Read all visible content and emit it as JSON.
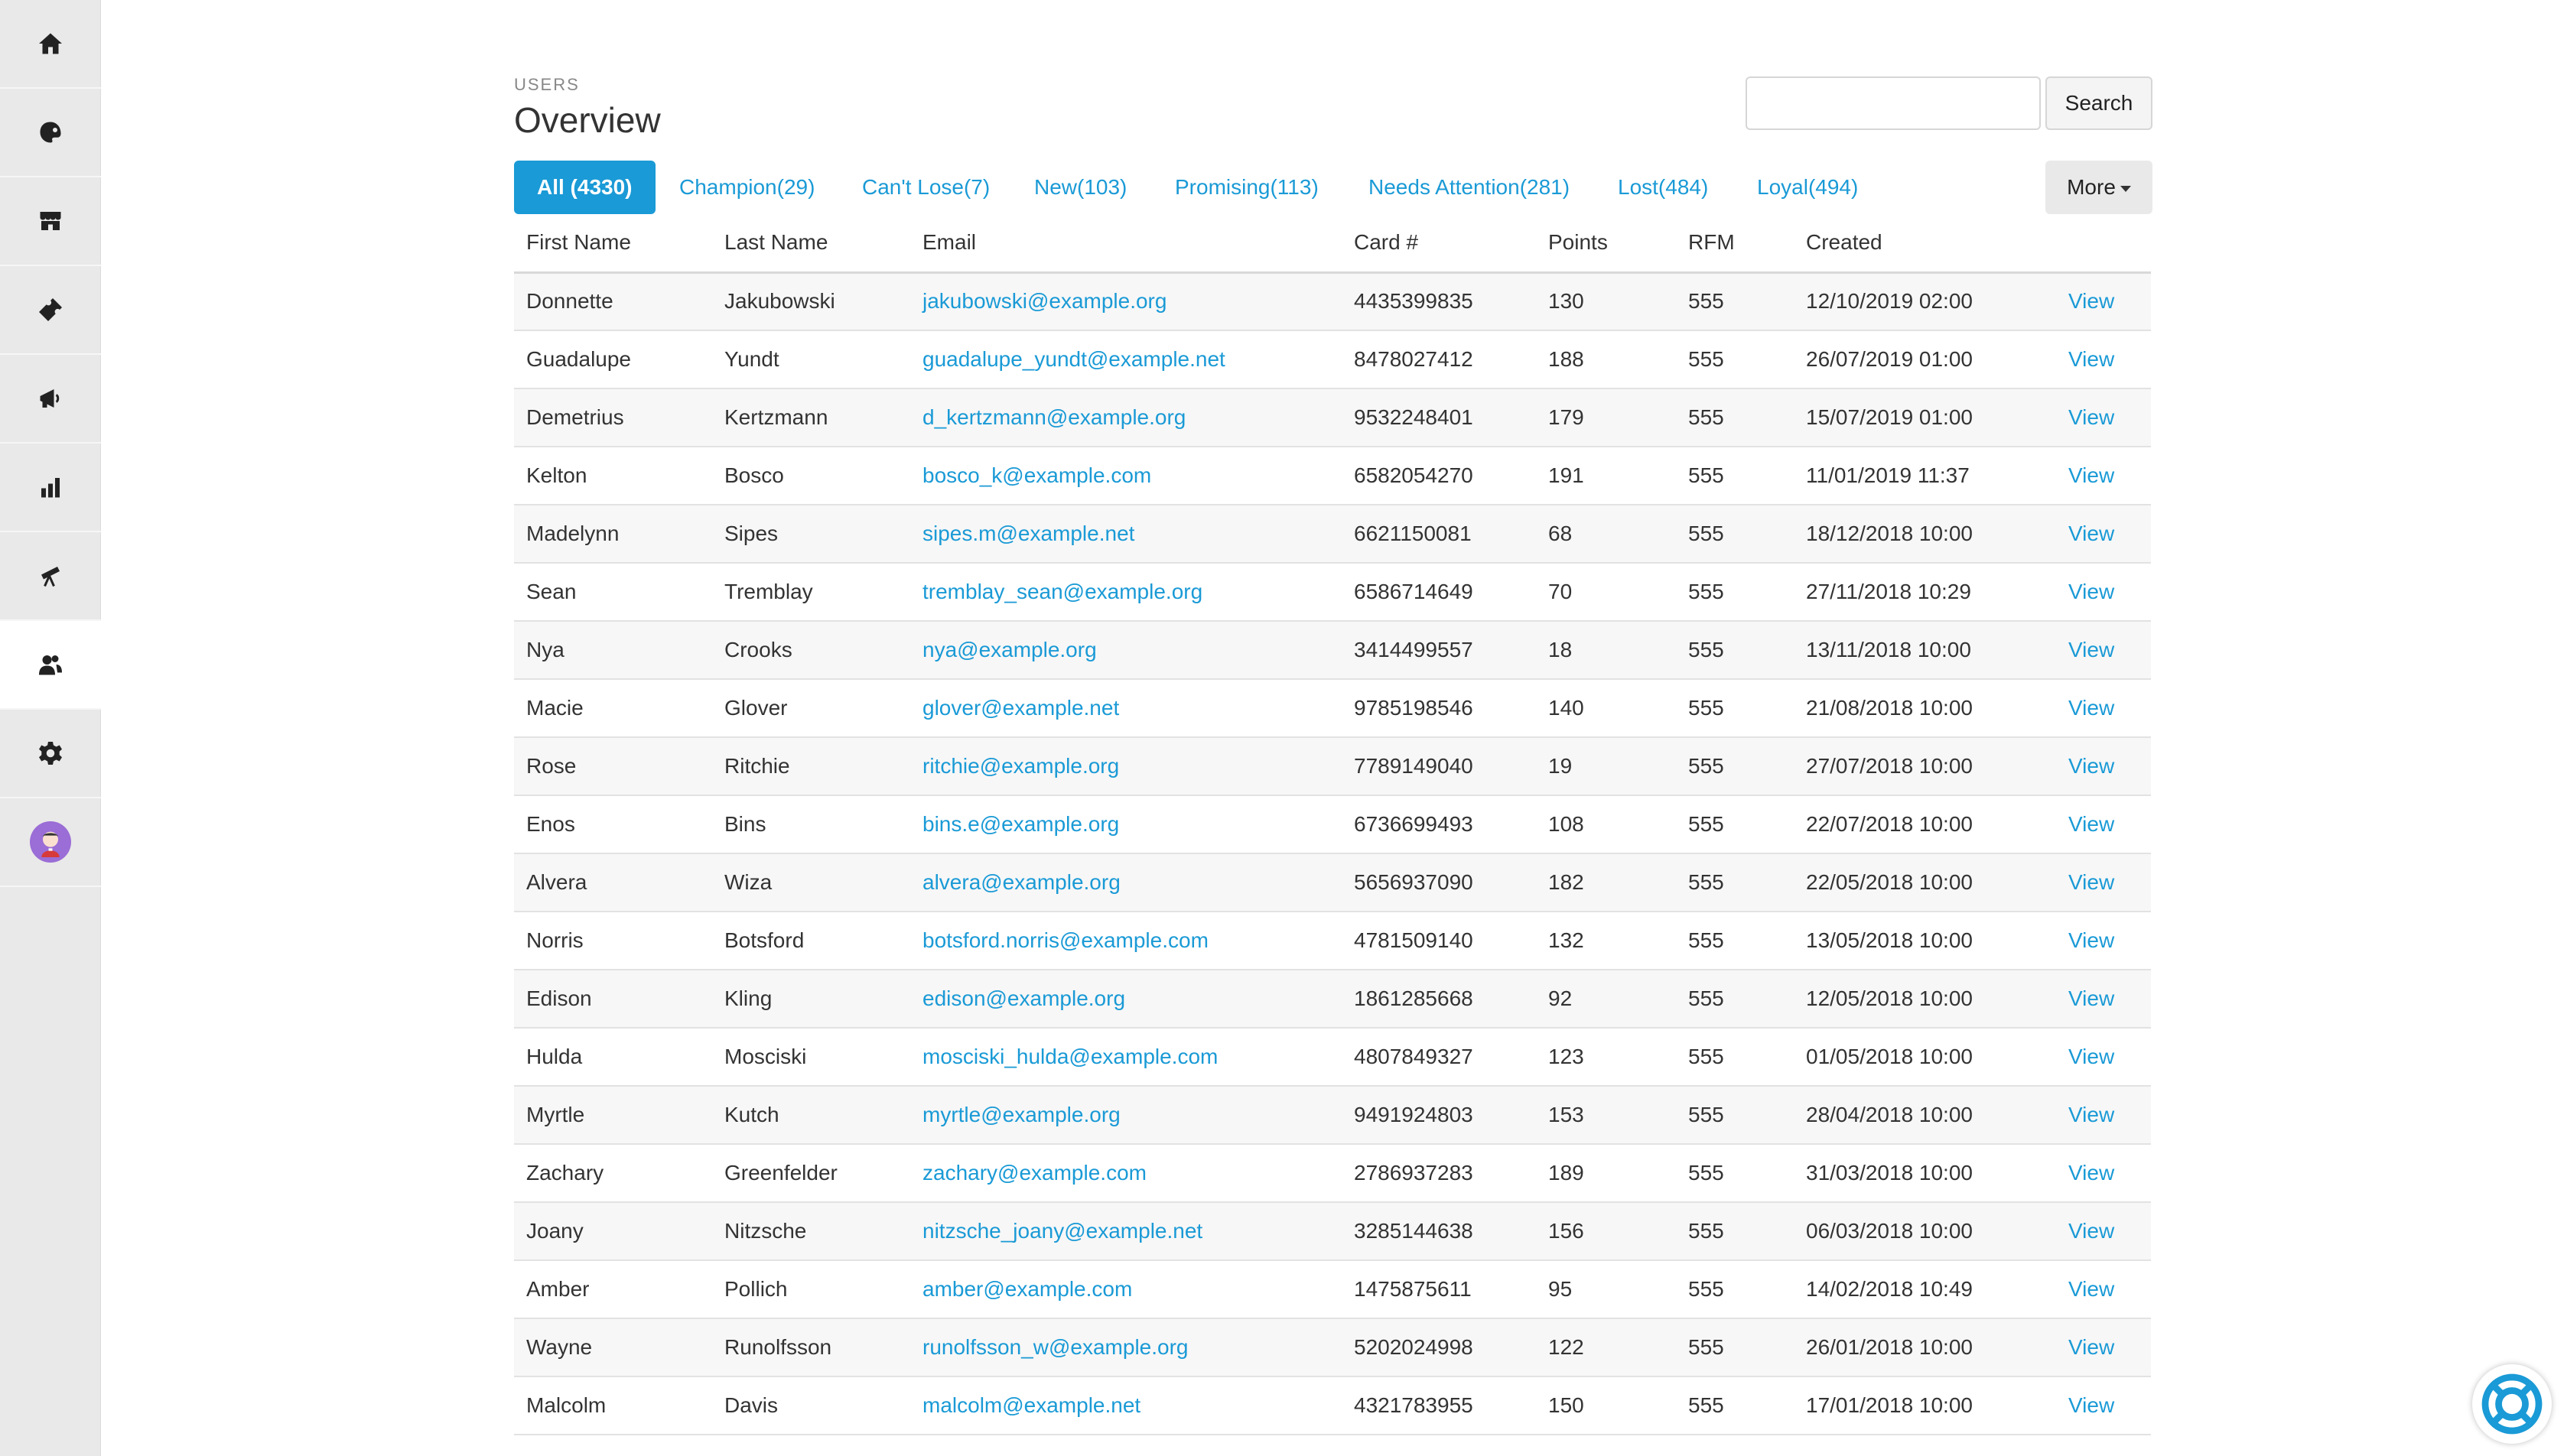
{
  "sidebar": {
    "items": [
      {
        "icon": "home-icon"
      },
      {
        "icon": "palette-icon"
      },
      {
        "icon": "store-icon"
      },
      {
        "icon": "ticket-icon"
      },
      {
        "icon": "megaphone-icon"
      },
      {
        "icon": "bar-chart-icon"
      },
      {
        "icon": "telescope-icon"
      },
      {
        "icon": "users-icon",
        "active": true
      },
      {
        "icon": "gear-icon"
      },
      {
        "icon": "avatar"
      }
    ]
  },
  "header": {
    "section": "USERS",
    "title": "Overview"
  },
  "search": {
    "value": "",
    "placeholder": "",
    "button_label": "Search"
  },
  "tabs": [
    {
      "label": "All (4330)",
      "active": true
    },
    {
      "label": "Champion(29)"
    },
    {
      "label": "Can't Lose(7)"
    },
    {
      "label": "New(103)"
    },
    {
      "label": "Promising(113)"
    },
    {
      "label": "Needs Attention(281)"
    },
    {
      "label": "Lost(484)"
    },
    {
      "label": "Loyal(494)"
    }
  ],
  "more_label": "More",
  "table": {
    "columns": [
      "First Name",
      "Last Name",
      "Email",
      "Card #",
      "Points",
      "RFM",
      "Created",
      ""
    ],
    "action_label": "View",
    "rows": [
      [
        "Donnette",
        "Jakubowski",
        "jakubowski@example.org",
        "4435399835",
        "130",
        "555",
        "12/10/2019 02:00"
      ],
      [
        "Guadalupe",
        "Yundt",
        "guadalupe_yundt@example.net",
        "8478027412",
        "188",
        "555",
        "26/07/2019 01:00"
      ],
      [
        "Demetrius",
        "Kertzmann",
        "d_kertzmann@example.org",
        "9532248401",
        "179",
        "555",
        "15/07/2019 01:00"
      ],
      [
        "Kelton",
        "Bosco",
        "bosco_k@example.com",
        "6582054270",
        "191",
        "555",
        "11/01/2019 11:37"
      ],
      [
        "Madelynn",
        "Sipes",
        "sipes.m@example.net",
        "6621150081",
        "68",
        "555",
        "18/12/2018 10:00"
      ],
      [
        "Sean",
        "Tremblay",
        "tremblay_sean@example.org",
        "6586714649",
        "70",
        "555",
        "27/11/2018 10:29"
      ],
      [
        "Nya",
        "Crooks",
        "nya@example.org",
        "3414499557",
        "18",
        "555",
        "13/11/2018 10:00"
      ],
      [
        "Macie",
        "Glover",
        "glover@example.net",
        "9785198546",
        "140",
        "555",
        "21/08/2018 10:00"
      ],
      [
        "Rose",
        "Ritchie",
        "ritchie@example.org",
        "7789149040",
        "19",
        "555",
        "27/07/2018 10:00"
      ],
      [
        "Enos",
        "Bins",
        "bins.e@example.org",
        "6736699493",
        "108",
        "555",
        "22/07/2018 10:00"
      ],
      [
        "Alvera",
        "Wiza",
        "alvera@example.org",
        "5656937090",
        "182",
        "555",
        "22/05/2018 10:00"
      ],
      [
        "Norris",
        "Botsford",
        "botsford.norris@example.com",
        "4781509140",
        "132",
        "555",
        "13/05/2018 10:00"
      ],
      [
        "Edison",
        "Kling",
        "edison@example.org",
        "1861285668",
        "92",
        "555",
        "12/05/2018 10:00"
      ],
      [
        "Hulda",
        "Mosciski",
        "mosciski_hulda@example.com",
        "4807849327",
        "123",
        "555",
        "01/05/2018 10:00"
      ],
      [
        "Myrtle",
        "Kutch",
        "myrtle@example.org",
        "9491924803",
        "153",
        "555",
        "28/04/2018 10:00"
      ],
      [
        "Zachary",
        "Greenfelder",
        "zachary@example.com",
        "2786937283",
        "189",
        "555",
        "31/03/2018 10:00"
      ],
      [
        "Joany",
        "Nitzsche",
        "nitzsche_joany@example.net",
        "3285144638",
        "156",
        "555",
        "06/03/2018 10:00"
      ],
      [
        "Amber",
        "Pollich",
        "amber@example.com",
        "1475875611",
        "95",
        "555",
        "14/02/2018 10:49"
      ],
      [
        "Wayne",
        "Runolfsson",
        "runolfsson_w@example.org",
        "5202024998",
        "122",
        "555",
        "26/01/2018 10:00"
      ],
      [
        "Malcolm",
        "Davis",
        "malcolm@example.net",
        "4321783955",
        "150",
        "555",
        "17/01/2018 10:00"
      ]
    ]
  },
  "colors": {
    "accent": "#1a9ad6",
    "sidebar_bg": "#e9e9e9",
    "row_alt": "#f7f7f7"
  },
  "help_widget": {
    "icon": "lifebuoy-icon"
  }
}
